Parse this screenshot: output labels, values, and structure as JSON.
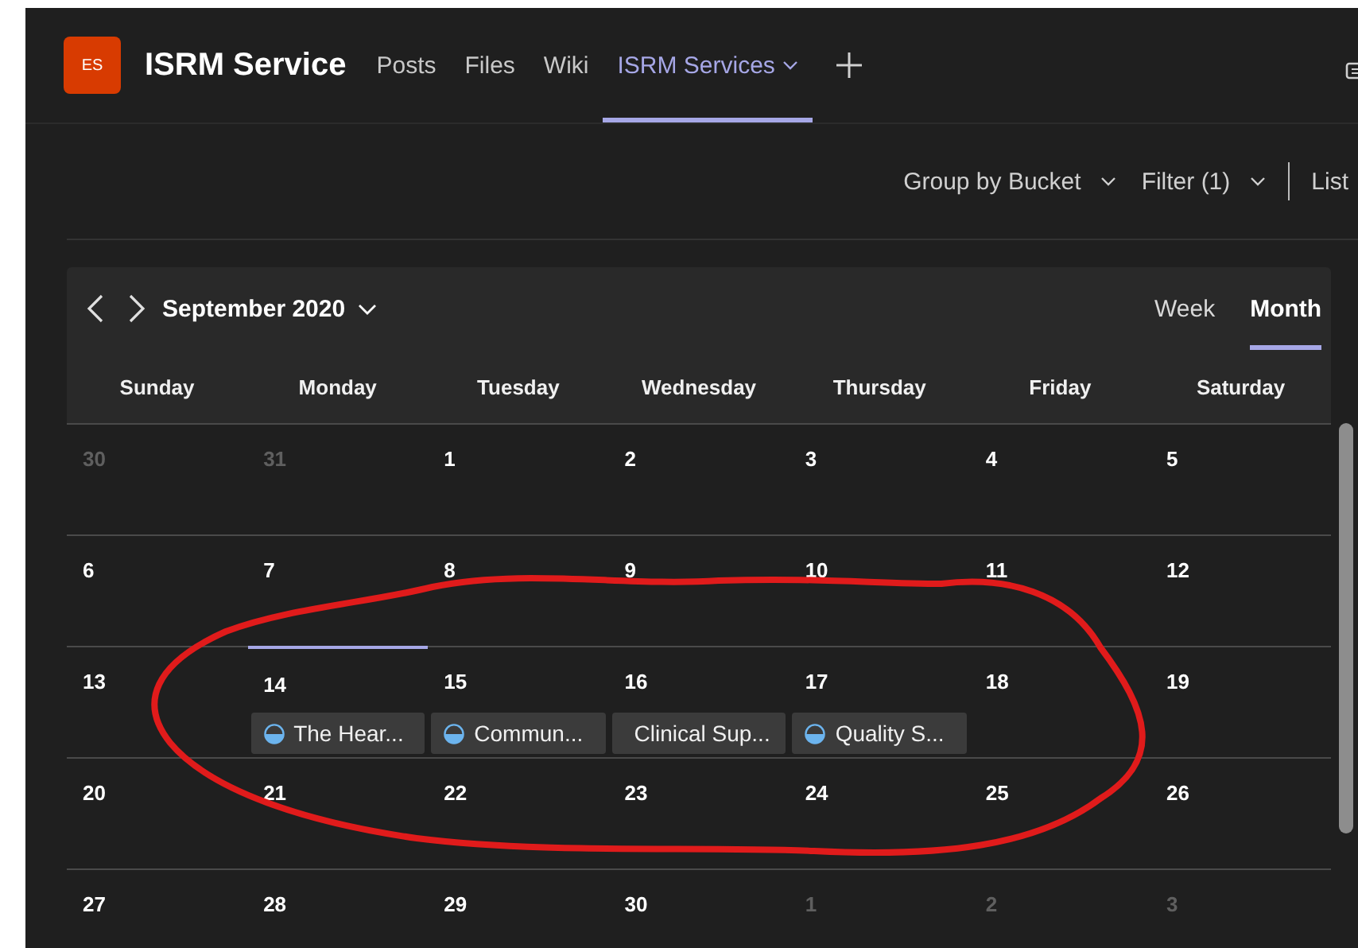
{
  "team": {
    "avatar": "ES",
    "name": "ISRM Service"
  },
  "tabs": [
    {
      "label": "Posts",
      "selected": false,
      "dropdown": false
    },
    {
      "label": "Files",
      "selected": false,
      "dropdown": false
    },
    {
      "label": "Wiki",
      "selected": false,
      "dropdown": false
    },
    {
      "label": "ISRM Services",
      "selected": true,
      "dropdown": true
    }
  ],
  "toolbar": {
    "group_by": "Group by Bucket",
    "filter": "Filter (1)",
    "view": "List"
  },
  "calendar": {
    "title": "September 2020",
    "views": [
      {
        "label": "Week",
        "selected": false
      },
      {
        "label": "Month",
        "selected": true
      }
    ],
    "weekdays": [
      "Sunday",
      "Monday",
      "Tuesday",
      "Wednesday",
      "Thursday",
      "Friday",
      "Saturday"
    ],
    "weeks": [
      {
        "days": [
          {
            "label": "30",
            "muted": true,
            "today": false
          },
          {
            "label": "31",
            "muted": true,
            "today": false
          },
          {
            "label": "1",
            "muted": false,
            "today": false
          },
          {
            "label": "2",
            "muted": false,
            "today": false
          },
          {
            "label": "3",
            "muted": false,
            "today": false
          },
          {
            "label": "4",
            "muted": false,
            "today": false
          },
          {
            "label": "5",
            "muted": false,
            "today": false
          }
        ]
      },
      {
        "days": [
          {
            "label": "6",
            "muted": false,
            "today": false
          },
          {
            "label": "7",
            "muted": false,
            "today": false
          },
          {
            "label": "8",
            "muted": false,
            "today": false
          },
          {
            "label": "9",
            "muted": false,
            "today": false
          },
          {
            "label": "10",
            "muted": false,
            "today": false
          },
          {
            "label": "11",
            "muted": false,
            "today": false
          },
          {
            "label": "12",
            "muted": false,
            "today": false
          }
        ]
      },
      {
        "days": [
          {
            "label": "13",
            "muted": false,
            "today": false
          },
          {
            "label": "14",
            "muted": false,
            "today": true,
            "events": [
              {
                "title": "The Hear...",
                "in_progress": true
              }
            ]
          },
          {
            "label": "15",
            "muted": false,
            "today": false,
            "events": [
              {
                "title": "Commun...",
                "in_progress": true
              }
            ]
          },
          {
            "label": "16",
            "muted": false,
            "today": false,
            "events": [
              {
                "title": "Clinical Sup...",
                "in_progress": false
              }
            ]
          },
          {
            "label": "17",
            "muted": false,
            "today": false,
            "events": [
              {
                "title": "Quality S...",
                "in_progress": true
              }
            ]
          },
          {
            "label": "18",
            "muted": false,
            "today": false
          },
          {
            "label": "19",
            "muted": false,
            "today": false
          }
        ]
      },
      {
        "days": [
          {
            "label": "20",
            "muted": false,
            "today": false
          },
          {
            "label": "21",
            "muted": false,
            "today": false
          },
          {
            "label": "22",
            "muted": false,
            "today": false
          },
          {
            "label": "23",
            "muted": false,
            "today": false
          },
          {
            "label": "24",
            "muted": false,
            "today": false
          },
          {
            "label": "25",
            "muted": false,
            "today": false
          },
          {
            "label": "26",
            "muted": false,
            "today": false
          }
        ]
      },
      {
        "days": [
          {
            "label": "27",
            "muted": false,
            "today": false
          },
          {
            "label": "28",
            "muted": false,
            "today": false
          },
          {
            "label": "29",
            "muted": false,
            "today": false
          },
          {
            "label": "30",
            "muted": false,
            "today": false
          },
          {
            "label": "1",
            "muted": true,
            "today": false
          },
          {
            "label": "2",
            "muted": true,
            "today": false
          },
          {
            "label": "3",
            "muted": true,
            "today": false
          }
        ]
      }
    ]
  }
}
